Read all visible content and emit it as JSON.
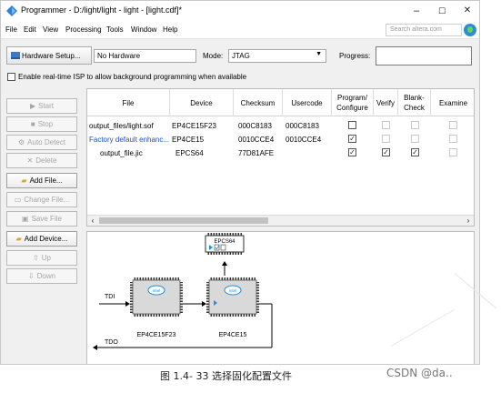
{
  "window": {
    "title": "Programmer - D:/light/light - light - [light.cdf]*",
    "controls": {
      "minimize": "–",
      "maximize": "☐",
      "close": "✕"
    }
  },
  "menu": {
    "items": [
      "File",
      "Edit",
      "View",
      "Processing",
      "Tools",
      "Window",
      "Help"
    ],
    "search_placeholder": "Search altera.com"
  },
  "toolbar": {
    "hardware_setup_label": "Hardware Setup...",
    "hardware_value": "No Hardware",
    "mode_label": "Mode:",
    "mode_value": "JTAG",
    "progress_label": "Progress:",
    "progress_value": ""
  },
  "realtime_isp_label": "Enable real-time ISP to allow background programming when available",
  "side_buttons": [
    {
      "label": "Start",
      "icon": "start-icon",
      "enabled": false
    },
    {
      "label": "Stop",
      "icon": "stop-icon",
      "enabled": false
    },
    {
      "label": "Auto Detect",
      "icon": "auto-detect-icon",
      "enabled": false
    },
    {
      "label": "Delete",
      "icon": "delete-icon",
      "enabled": false
    },
    {
      "label": "Add File...",
      "icon": "add-file-icon",
      "enabled": true
    },
    {
      "label": "Change File...",
      "icon": "change-file-icon",
      "enabled": false
    },
    {
      "label": "Save File",
      "icon": "save-file-icon",
      "enabled": false
    },
    {
      "label": "Add Device...",
      "icon": "add-device-icon",
      "enabled": true
    },
    {
      "label": "Up",
      "icon": "up-icon",
      "enabled": false
    },
    {
      "label": "Down",
      "icon": "down-icon",
      "enabled": false
    }
  ],
  "table": {
    "columns": [
      "File",
      "Device",
      "Checksum",
      "Usercode",
      "Program/ Configure",
      "Verify",
      "Blank-Check",
      "Examine"
    ],
    "rows": [
      {
        "file": "output_files/light.sof",
        "device": "EP4CE15F23",
        "checksum": "000C8183",
        "usercode": "000C8183",
        "program": false,
        "verify": false,
        "blank": false,
        "examine": false,
        "program_enabled": true,
        "verify_enabled": false,
        "blank_enabled": false,
        "examine_enabled": false
      },
      {
        "file": "Factory default enhanc...",
        "device": "EP4CE15",
        "checksum": "0010CCE4",
        "usercode": "0010CCE4",
        "program": true,
        "verify": false,
        "blank": false,
        "examine": false,
        "program_enabled": true,
        "verify_enabled": false,
        "blank_enabled": false,
        "examine_enabled": false
      },
      {
        "file": "output_file.jic",
        "device": "EPCS64",
        "checksum": "77D81AFE",
        "usercode": "",
        "program": true,
        "verify": true,
        "blank": true,
        "examine": false,
        "program_enabled": true,
        "verify_enabled": true,
        "blank_enabled": true,
        "examine_enabled": false
      }
    ]
  },
  "diagram": {
    "flash_label": "EPCS64",
    "chip1_label": "EP4CE15F23",
    "chip2_label": "EP4CE15",
    "chip_logo": "intel",
    "tdi_label": "TDI",
    "tdo_label": "TDO"
  },
  "caption": "图 1.4- 33 选择固化配置文件",
  "watermark": "CSDN @da..",
  "colors": {
    "link_blue": "#1f4fcf",
    "chip_blue": "#1e8fe0"
  }
}
